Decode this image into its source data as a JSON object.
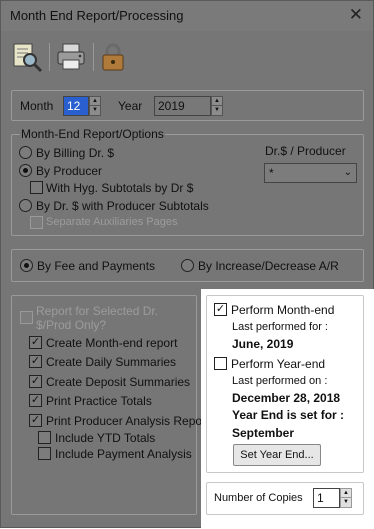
{
  "window": {
    "title": "Month End Report/Processing",
    "close_glyph": "✕"
  },
  "toolbar": {
    "buttons": [
      {
        "icon": "magnifier-report-icon"
      },
      {
        "icon": "printer-icon"
      },
      {
        "icon": "lock-icon"
      }
    ]
  },
  "period": {
    "month_label": "Month",
    "month_value": "12",
    "year_label": "Year",
    "year_value": "2019"
  },
  "report_options": {
    "group_label": "Month-End Report/Options",
    "by_billing": "By Billing Dr. $",
    "by_producer": "By Producer",
    "with_hyg": "With Hyg. Subtotals by Dr $",
    "by_dr_producer": "By Dr. $ with Producer Subtotals",
    "separate_aux": "Separate Auxiliaries Pages",
    "dr_producer_label": "Dr.$ / Producer",
    "dr_producer_value": "*",
    "selected": "by_producer"
  },
  "basis": {
    "by_fee": "By Fee and Payments",
    "by_increase": "By Increase/Decrease A/R",
    "selected": "by_fee"
  },
  "reports": {
    "for_selected": "Report for Selected Dr. $/Prod Only?",
    "create_monthend": "Create Month-end report",
    "create_daily": "Create Daily Summaries",
    "create_deposit": "Create Deposit Summaries",
    "print_practice": "Print Practice Totals",
    "print_producer": "Print Producer Analysis Report",
    "include_ytd": "Include YTD Totals",
    "include_payment": "Include Payment Analysis",
    "check_glyph": "✓"
  },
  "processing": {
    "perform_monthend": "Perform Month-end",
    "last_performed_for_label": "Last performed for :",
    "last_performed_for_value": "June, 2019",
    "perform_yearend": "Perform Year-end",
    "last_performed_on_label": "Last performed on :",
    "last_performed_on_value": "December 28, 2018",
    "year_end_set_label": "Year End is set for :",
    "year_end_set_value": "September",
    "set_year_end_button": "Set Year End..."
  },
  "copies": {
    "label": "Number of Copies",
    "value": "1"
  },
  "spin": {
    "up": "▲",
    "down": "▼"
  },
  "dropdown_glyph": "⌄"
}
